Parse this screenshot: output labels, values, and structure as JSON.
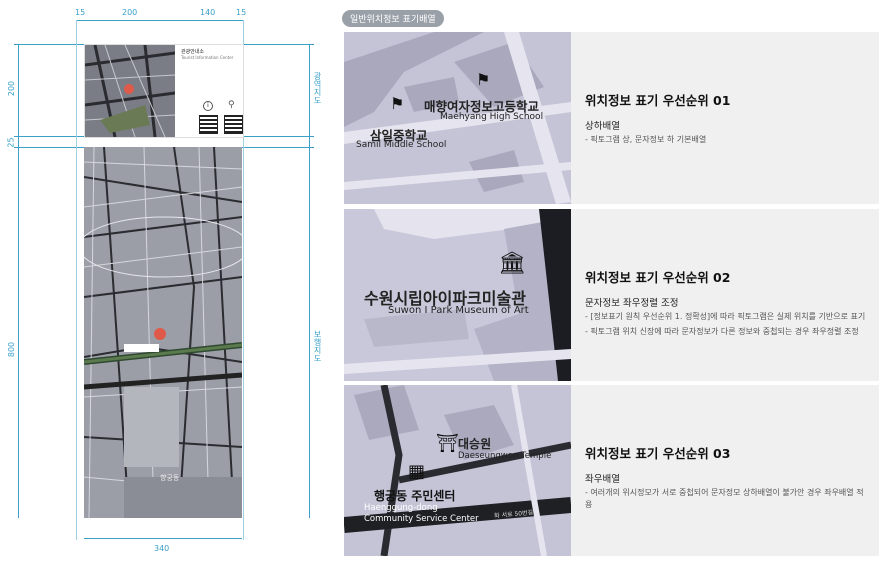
{
  "section_tag": "일반위치정보 표기배열",
  "dimensions": {
    "top_15_left": "15",
    "top_200": "200",
    "top_140": "140",
    "top_15_right": "15",
    "left_200": "200",
    "left_25": "25",
    "left_800": "800",
    "bottom_340": "340",
    "right_label_top": "광역지도",
    "right_label_bottom": "보행지도"
  },
  "sign": {
    "header_title": "관광안내소",
    "header_sub": "Tourist Information Center",
    "district_label": "향궁동"
  },
  "panels": [
    {
      "title": "위치정보 표기 우선순위 01",
      "subtitle": "상하배열",
      "desc": [
        "- 픽토그램 상, 문자정보 하 기본배열"
      ],
      "map_labels": {
        "a_ko": "매향여자정보고등학교",
        "a_en": "Maehyang High School",
        "b_ko": "삼일중학교",
        "b_en": "Samil Middle School"
      }
    },
    {
      "title": "위치정보 표기 우선순위 02",
      "subtitle": "문자정보 좌우정렬 조정",
      "desc": [
        "- [정보표기 원칙 우선순위 1. 정확성]에 따라 픽토그램은 실제 위치를 기반으로 표기",
        "- 픽토그램 위치 신장에 따라 문자정보가 다른 정보와 중첩되는 경우 좌우정렬 조정"
      ],
      "map_labels": {
        "a_ko": "수원시립아이파크미술관",
        "a_en": "Suwon I Park Museum of Art"
      }
    },
    {
      "title": "위치정보 표기 우선순위 03",
      "subtitle": "좌우배열",
      "desc": [
        "- 여러개의 위시정모가 서로 중첩되어 문자정모 상하배열이 불가안 경우 좌우배열 적용"
      ],
      "map_labels": {
        "a_ko": "대승원",
        "a_en": "Daeseungwon Temple",
        "b_ko": "행궁동 주민센터",
        "b_en": "Haenggung-dong Community Service Center",
        "road": "화 서로 50번길"
      }
    }
  ]
}
